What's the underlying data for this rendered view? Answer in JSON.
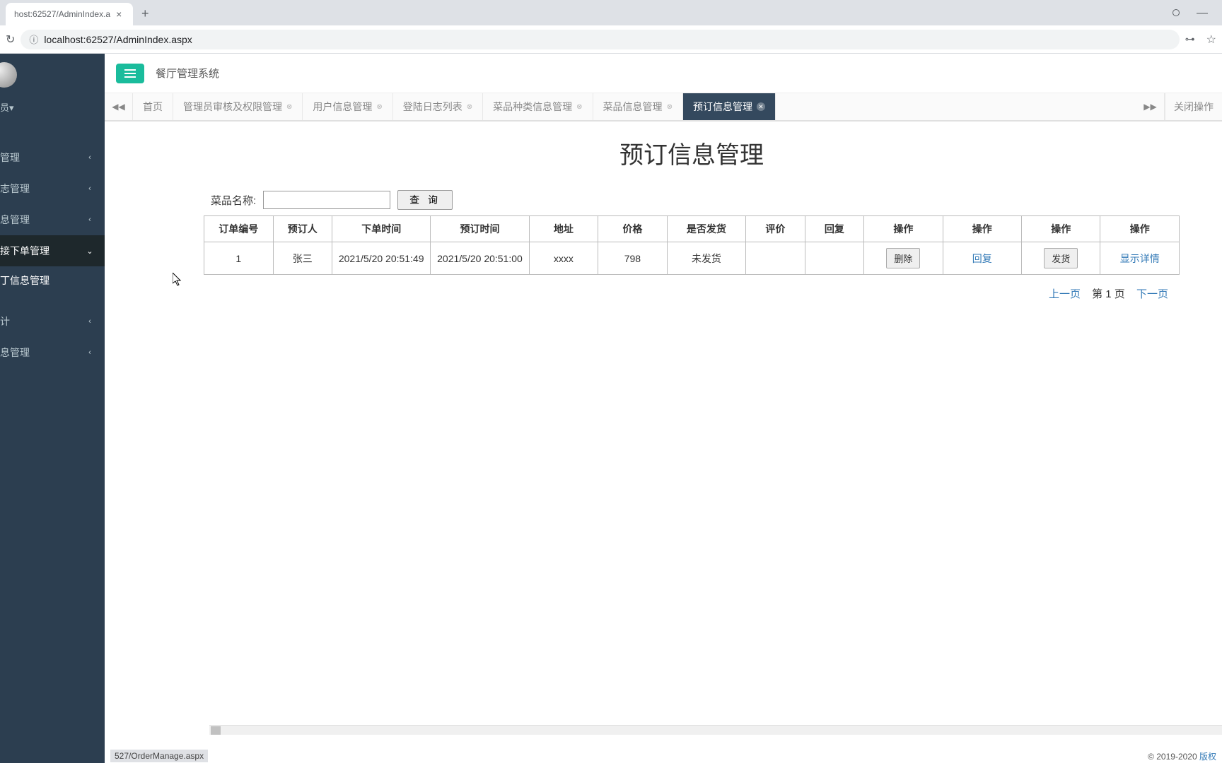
{
  "browser": {
    "tab_title": "host:62527/AdminIndex.a",
    "url": "localhost:62527/AdminIndex.aspx"
  },
  "sidebar": {
    "user_label": "员",
    "items": [
      {
        "label": "管理"
      },
      {
        "label": "志管理"
      },
      {
        "label": "息管理"
      },
      {
        "label": "接下单管理",
        "expanded": true
      },
      {
        "label": "计"
      },
      {
        "label": "息管理"
      }
    ],
    "sub_item": "丁信息管理"
  },
  "topbar": {
    "app_title": "餐厅管理系统"
  },
  "tabs": [
    {
      "label": "首页",
      "closable": false
    },
    {
      "label": "管理员审核及权限管理",
      "closable": true
    },
    {
      "label": "用户信息管理",
      "closable": true
    },
    {
      "label": "登陆日志列表",
      "closable": true
    },
    {
      "label": "菜品种类信息管理",
      "closable": true
    },
    {
      "label": "菜品信息管理",
      "closable": true
    },
    {
      "label": "预订信息管理",
      "closable": true,
      "active": true
    }
  ],
  "close_ops": "关闭操作",
  "page": {
    "title": "预订信息管理",
    "search_label": "菜品名称:",
    "search_value": "",
    "search_btn": "查 询"
  },
  "table": {
    "headers": [
      "订单编号",
      "预订人",
      "下单时间",
      "预订时间",
      "地址",
      "价格",
      "是否发货",
      "评价",
      "回复",
      "操作",
      "操作",
      "操作",
      "操作"
    ],
    "rows": [
      {
        "order_id": "1",
        "person": "张三",
        "order_time": "2021/5/20 20:51:49",
        "reserve_time": "2021/5/20 20:51:00",
        "address": "xxxx",
        "price": "798",
        "shipped": "未发货",
        "eval": "",
        "reply": "",
        "op_delete": "删除",
        "op_reply": "回复",
        "op_ship": "发货",
        "op_detail": "显示详情"
      }
    ]
  },
  "pager": {
    "prev": "上一页",
    "current": "第 1 页",
    "next": "下一页"
  },
  "status": {
    "left": "527/OrderManage.aspx",
    "right_text": "© 2019-2020 ",
    "right_link": "版权"
  }
}
